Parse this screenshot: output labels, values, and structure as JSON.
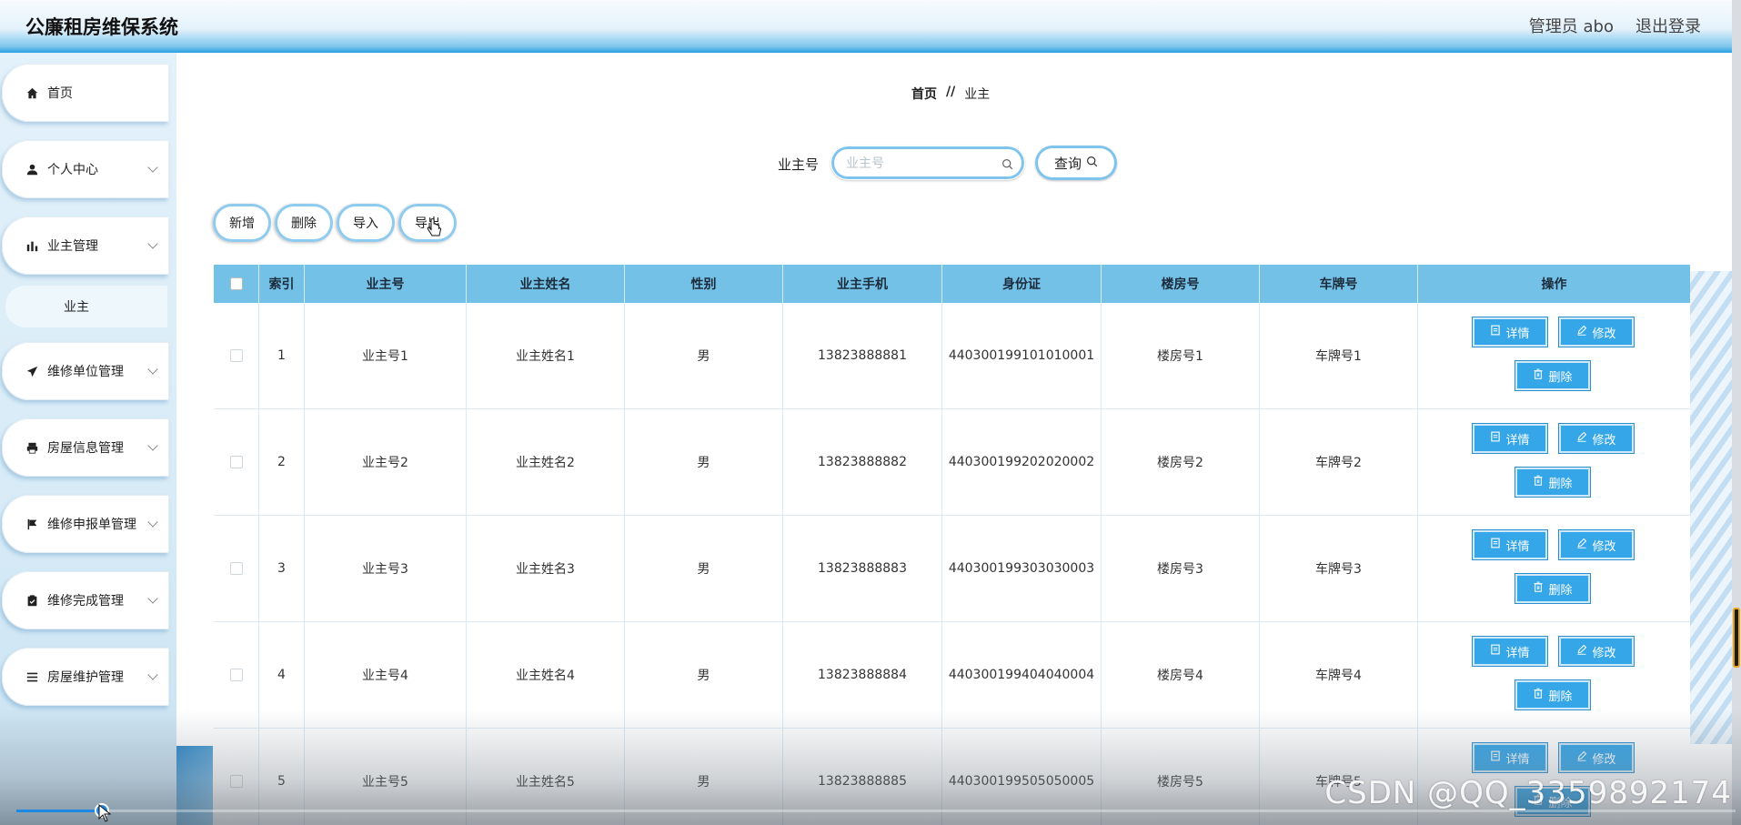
{
  "header": {
    "app_title": "公廉租房维保系统",
    "user_label": "管理员 abo",
    "logout_label": "退出登录"
  },
  "sidebar": {
    "items": [
      {
        "label": "首页",
        "icon": "home-icon",
        "has_children": false
      },
      {
        "label": "个人中心",
        "icon": "user-icon",
        "has_children": true
      },
      {
        "label": "业主管理",
        "icon": "bar-chart-icon",
        "has_children": true
      },
      {
        "label": "维修单位管理",
        "icon": "send-icon",
        "has_children": true
      },
      {
        "label": "房屋信息管理",
        "icon": "printer-icon",
        "has_children": true
      },
      {
        "label": "维修申报单管理",
        "icon": "flag-icon",
        "has_children": true
      },
      {
        "label": "维修完成管理",
        "icon": "clipboard-icon",
        "has_children": true
      },
      {
        "label": "房屋维护管理",
        "icon": "list-icon",
        "has_children": true
      }
    ],
    "active_sub": "业主"
  },
  "breadcrumb": {
    "home": "首页",
    "separator": "//",
    "current": "业主"
  },
  "search": {
    "label": "业主号",
    "placeholder": "业主号",
    "button_label": "查询"
  },
  "toolbar": {
    "add": "新增",
    "delete": "删除",
    "import": "导入",
    "export": "导出"
  },
  "table": {
    "columns": [
      "",
      "索引",
      "业主号",
      "业主姓名",
      "性别",
      "业主手机",
      "身份证",
      "楼房号",
      "车牌号",
      "操作"
    ],
    "rows": [
      {
        "index": "1",
        "owner_no": "业主号1",
        "name": "业主姓名1",
        "gender": "男",
        "phone": "13823888881",
        "id_card": "440300199101010001",
        "building": "楼房号1",
        "plate": "车牌号1"
      },
      {
        "index": "2",
        "owner_no": "业主号2",
        "name": "业主姓名2",
        "gender": "男",
        "phone": "13823888882",
        "id_card": "440300199202020002",
        "building": "楼房号2",
        "plate": "车牌号2"
      },
      {
        "index": "3",
        "owner_no": "业主号3",
        "name": "业主姓名3",
        "gender": "男",
        "phone": "13823888883",
        "id_card": "440300199303030003",
        "building": "楼房号3",
        "plate": "车牌号3"
      },
      {
        "index": "4",
        "owner_no": "业主号4",
        "name": "业主姓名4",
        "gender": "男",
        "phone": "13823888884",
        "id_card": "440300199404040004",
        "building": "楼房号4",
        "plate": "车牌号4"
      },
      {
        "index": "5",
        "owner_no": "业主号5",
        "name": "业主姓名5",
        "gender": "男",
        "phone": "13823888885",
        "id_card": "440300199505050005",
        "building": "楼房号5",
        "plate": "车牌号5"
      }
    ],
    "actions": {
      "detail": "详情",
      "edit": "修改",
      "delete": "删除"
    }
  },
  "overlay": {
    "watermark": "CSDN @QQ_3359892174",
    "video_progress": 0.05
  },
  "colors": {
    "accent": "#35a6e8",
    "header_row": "#74c1e8",
    "topbar_edge": "#2a9fe0"
  }
}
